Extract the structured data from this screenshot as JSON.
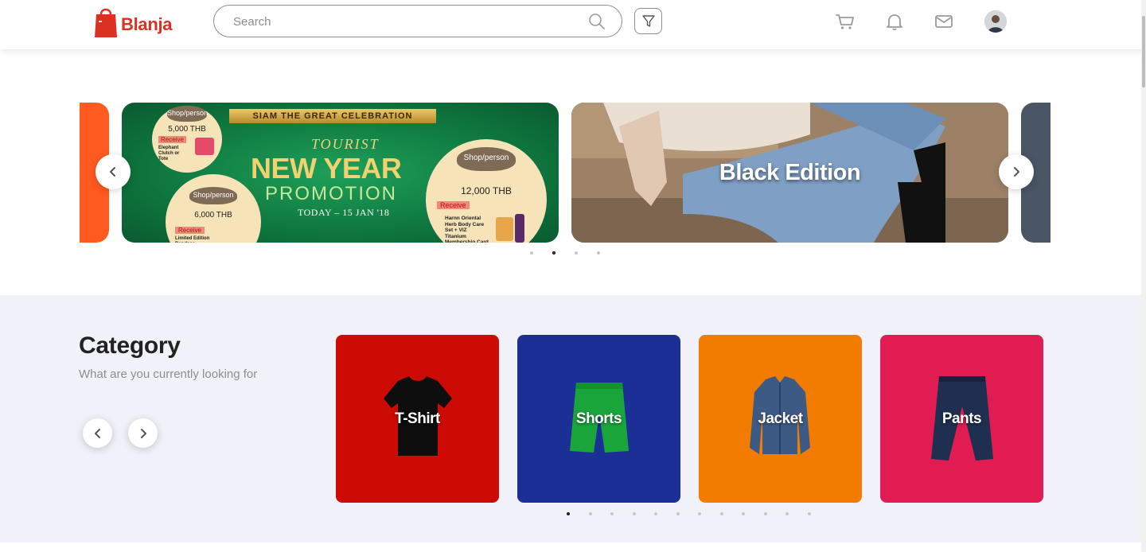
{
  "header": {
    "brand": "Blanja",
    "search_placeholder": "Search",
    "icons": [
      "search-icon",
      "filter-icon",
      "cart-icon",
      "bell-icon",
      "mail-icon",
      "avatar"
    ]
  },
  "banner": {
    "promo": {
      "ribbon": "SIAM THE GREAT CELEBRATION",
      "small_title": "TOURIST",
      "title": "NEW YEAR",
      "subtitle": "PROMOTION",
      "date": "TODAY – 15 JAN '18",
      "coupons": [
        {
          "cap": "Shop/person",
          "amount": "5,000 THB",
          "receive": "Receive",
          "item": "Elephant Clutch or Tote"
        },
        {
          "cap": "Shop/person",
          "amount": "6,000 THB",
          "receive": "Receive",
          "item": "Limited Edition Bandana"
        },
        {
          "cap": "Shop/person",
          "amount": "12,000 THB",
          "receive": "Receive",
          "item": "Harnn Oriental Herb Body Care Set + VIZ Titanium Membership Card"
        }
      ]
    },
    "black_edition_title": "Black Edition",
    "dots": 4,
    "active_dot": 1
  },
  "category": {
    "title": "Category",
    "subtitle": "What are you currently looking for",
    "cards": [
      {
        "label": "T-Shirt",
        "color": "#cc0b04"
      },
      {
        "label": "Shorts",
        "color": "#1b2f96"
      },
      {
        "label": "Jacket",
        "color": "#f27c02"
      },
      {
        "label": "Pants",
        "color": "#e01c53"
      }
    ],
    "dots": 12,
    "active_dot": 0
  },
  "colors": {
    "brand": "#db3022",
    "category_bg": "#f0f1f9"
  }
}
